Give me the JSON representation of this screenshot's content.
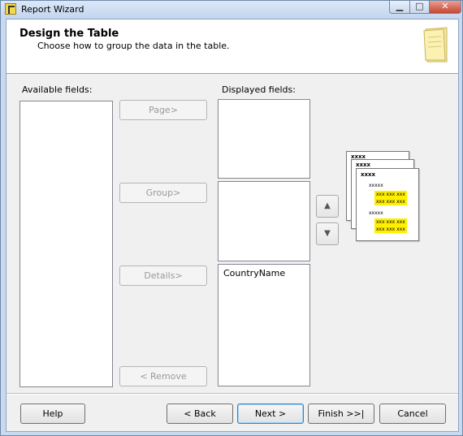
{
  "window": {
    "title": "Report Wizard"
  },
  "header": {
    "title": "Design the Table",
    "subtitle": "Choose how to group the data in the table."
  },
  "available": {
    "label": "Available fields:",
    "items": []
  },
  "displayed": {
    "label": "Displayed fields:",
    "page_items": [],
    "group_items": [],
    "detail_items": [
      "CountryName"
    ]
  },
  "buttons": {
    "page": "Page>",
    "group": "Group>",
    "details": "Details>",
    "remove": "< Remove",
    "help": "Help",
    "back": "< Back",
    "next": "Next >",
    "finish": "Finish >>|",
    "cancel": "Cancel"
  },
  "preview": {
    "header_text": "xxxx",
    "group_text": "xxxxx",
    "detail_text": "xxx xxx xxx",
    "highlight_color": "#ffef00"
  },
  "icons": {
    "move_up": "arrow-up-icon",
    "move_down": "arrow-down-icon",
    "minimize": "minimize-icon",
    "maximize": "maximize-icon",
    "close": "close-icon"
  }
}
